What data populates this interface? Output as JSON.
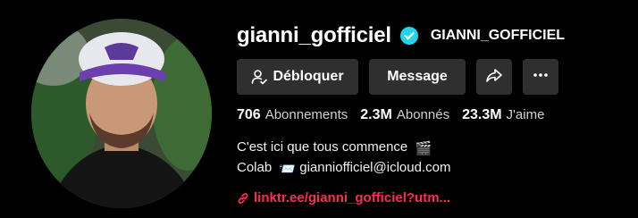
{
  "profile": {
    "username": "gianni_gofficiel",
    "nickname": "GIANNI_GOFFICIEL",
    "verified": true,
    "accent_color": "#fe2c55",
    "verified_color": "#20d5ec"
  },
  "actions": {
    "unblock_label": "Débloquer",
    "message_label": "Message",
    "share_icon": "share-icon",
    "more_icon": "more-icon"
  },
  "stats": {
    "following_count": "706",
    "following_label": "Abonnements",
    "followers_count": "2.3M",
    "followers_label": "Abonnés",
    "likes_count": "23.3M",
    "likes_label": "J'aime"
  },
  "bio": {
    "line1": "C'est ici que tous commence",
    "line1_emoji": "🎬",
    "line2_prefix": "Colab",
    "line2_emoji": "📨",
    "line2_email": "gianniofficiel@icloud.com"
  },
  "link": {
    "text": "linktr.ee/gianni_gofficiel?utm..."
  }
}
